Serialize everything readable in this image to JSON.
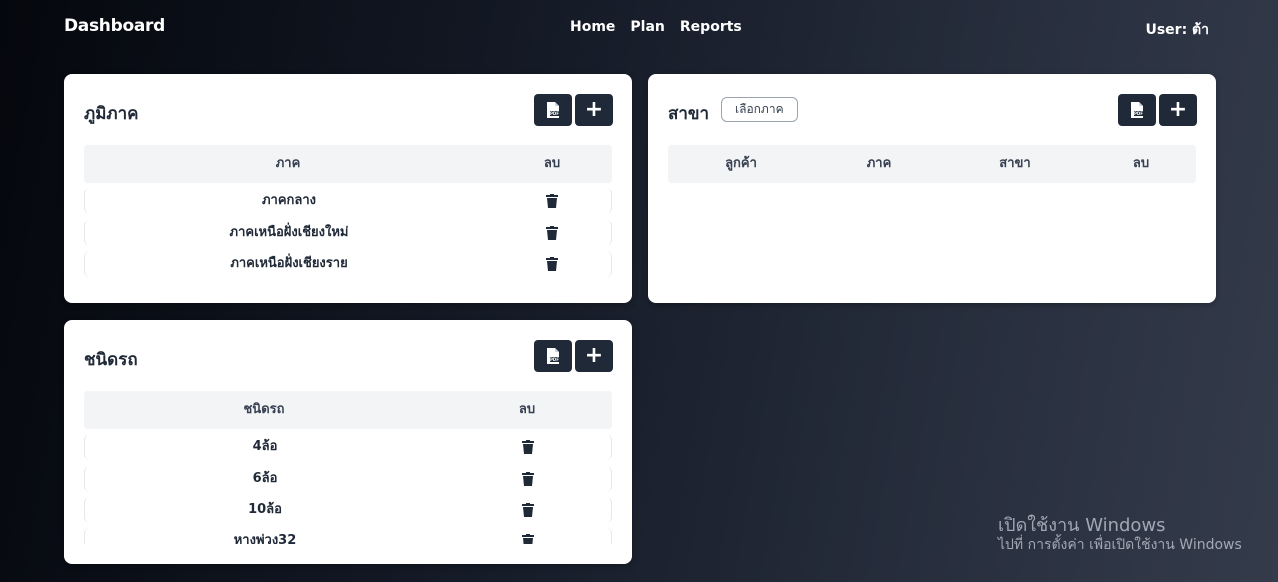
{
  "nav": {
    "brand": "Dashboard",
    "links": [
      "Home",
      "Plan",
      "Reports"
    ],
    "user": "User: ต้า"
  },
  "region_card": {
    "title": "ภูมิภาค",
    "pdf_icon": "pdf-file-icon",
    "columns": [
      "ภาค",
      "ลบ"
    ],
    "rows": [
      "ภาคกลาง",
      "ภาคเหนือฝั่งเชียงใหม่",
      "ภาคเหนือฝั่งเชียงราย"
    ]
  },
  "branch_card": {
    "title": "สาขา",
    "select_label": "เลือกภาค",
    "columns": [
      "ลูกค้า",
      "ภาค",
      "สาขา",
      "ลบ"
    ],
    "rows": []
  },
  "vehicle_card": {
    "title": "ชนิดรถ",
    "columns": [
      "ชนิดรถ",
      "ลบ"
    ],
    "rows": [
      "4ล้อ",
      "6ล้อ",
      "10ล้อ",
      "หางพ่วง32"
    ]
  },
  "watermark": {
    "line1": "เปิดใช้งาน Windows",
    "line2": "ไปที่ การตั้งค่า เพื่อเปิดใช้งาน Windows"
  },
  "colors": {
    "dark": "#1f2937",
    "header_bg": "#f3f4f6"
  }
}
